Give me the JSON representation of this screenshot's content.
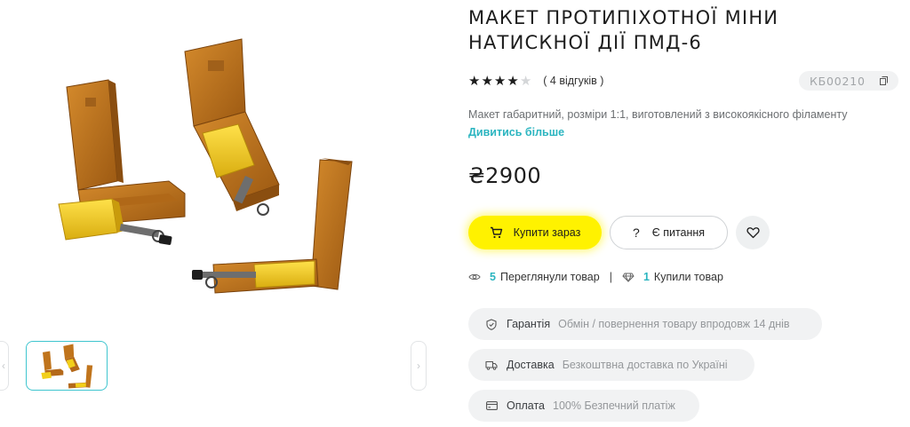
{
  "product": {
    "title_line1": "МАКЕТ ПРОТИПІХОТНОЇ МІНИ",
    "title_line2": "НАТИСКНОЇ ДІЇ ПМД-6",
    "rating": 4,
    "rating_max": 5,
    "reviews_text": "( 4 відгуків )",
    "sku": "КБ00210",
    "description": "Макет габаритний, розміри 1:1, виготовлений з високоякісного філаменту",
    "more_link": "Дивитись більше",
    "price": "₴2900"
  },
  "actions": {
    "buy_label": "Купити зараз",
    "ask_label": "Є питання",
    "ask_icon_glyph": "?"
  },
  "stats": {
    "viewed_count": "5",
    "viewed_label": "Переглянули товар",
    "separator": "|",
    "bought_count": "1",
    "bought_label": "Купили товар"
  },
  "info_pills": [
    {
      "icon": "shield-check-icon",
      "label": "Гарантія",
      "value": "Обмін / повернення товару впродовж 14 днів"
    },
    {
      "icon": "truck-icon",
      "label": "Доставка",
      "value": "Безкоштвна доставка по Україні"
    },
    {
      "icon": "card-icon",
      "label": "Оплата",
      "value": "100% Безпечний платіж"
    }
  ],
  "gallery": {
    "prev_glyph": "‹",
    "next_glyph": "›"
  },
  "colors": {
    "accent_yellow": "#fff200",
    "accent_teal": "#2bb5c0",
    "wood": "#c0741c",
    "wood_dark": "#8a4e10",
    "block_yellow": "#f2cf1a"
  }
}
